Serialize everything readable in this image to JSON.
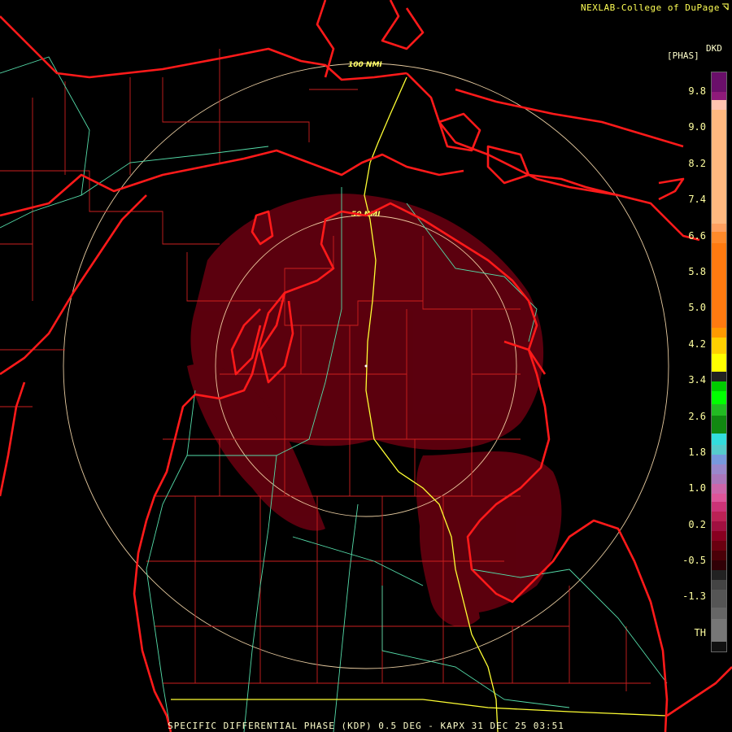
{
  "header": {
    "credit": "NEXLAB-College of DuPage"
  },
  "footer": {
    "caption": "SPECIFIC DIFFERENTIAL PHASE (KDP) 0.5 DEG - KAPX 31 DEC 25 03:51"
  },
  "legend": {
    "title": "[PHAS]",
    "unit": "DKD",
    "ticks": [
      "9.8",
      "9.0",
      "8.2",
      "7.4",
      "6.6",
      "5.8",
      "5.0",
      "4.2",
      "3.4",
      "2.6",
      "1.8",
      "1.0",
      "0.2",
      "-0.5",
      "-1.3",
      "TH"
    ]
  },
  "range_rings": {
    "inner_label": "50 NMI",
    "outer_label": "100 NMI"
  },
  "colors": {
    "coast": "#ff1a1a",
    "county": "#cc1f1f",
    "highway": "#ffff33",
    "state_road": "#55ddaa",
    "ring": "#ffe0b0",
    "echo": "#6b0010"
  }
}
